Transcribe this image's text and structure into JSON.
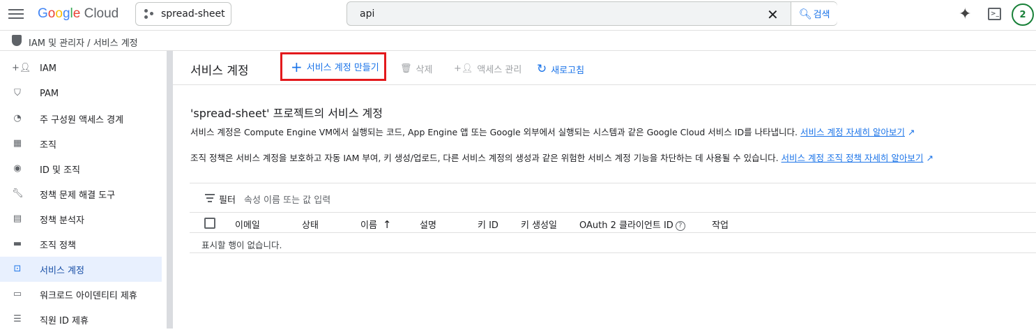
{
  "topbar": {
    "logo_google": "Google",
    "logo_cloud": "Cloud",
    "project": "spread-sheet",
    "search_value": "api",
    "search_button": "검색",
    "avatar": "2"
  },
  "breadcrumb": {
    "text": "IAM 및 관리자 / 서비스 계정"
  },
  "sidebar": {
    "items": [
      {
        "label": "IAM",
        "icon": "person-add-icon"
      },
      {
        "label": "PAM",
        "icon": "shield-icon"
      },
      {
        "label": "주 구성원 액세스 경계",
        "icon": "access-boundary-icon"
      },
      {
        "label": "조직",
        "icon": "organization-icon"
      },
      {
        "label": "ID 및 조직",
        "icon": "account-circle-icon"
      },
      {
        "label": "정책 문제 해결 도구",
        "icon": "wrench-icon"
      },
      {
        "label": "정책 분석자",
        "icon": "policy-analyzer-icon"
      },
      {
        "label": "조직 정책",
        "icon": "document-icon"
      },
      {
        "label": "서비스 계정",
        "icon": "service-account-icon"
      },
      {
        "label": "워크로드 아이덴티티 제휴",
        "icon": "id-card-icon"
      },
      {
        "label": "직원 ID 제휴",
        "icon": "list-icon"
      }
    ],
    "active_index": 8
  },
  "page": {
    "title": "서비스 계정",
    "toolbar": {
      "create": "서비스 계정 만들기",
      "delete": "삭제",
      "manage_access": "액세스 관리",
      "refresh": "새로고침"
    },
    "heading": "'spread-sheet' 프로젝트의 서비스 계정",
    "desc1": "서비스 계정은 Compute Engine VM에서 실행되는 코드, App Engine 앱 또는 Google 외부에서 실행되는 시스템과 같은 Google Cloud 서비스 ID를 나타냅니다.",
    "desc1_link": "서비스 계정 자세히 알아보기",
    "desc2": "조직 정책은 서비스 계정을 보호하고 자동 IAM 부여, 키 생성/업로드, 다른 서비스 계정의 생성과 같은 위험한 서비스 계정 기능을 차단하는 데 사용될 수 있습니다.",
    "desc2_link": "서비스 계정 조직 정책 자세히 알아보기"
  },
  "table": {
    "filter_label": "필터",
    "filter_placeholder": "속성 이름 또는 값 입력",
    "columns": [
      "이메일",
      "상태",
      "이름",
      "설명",
      "키 ID",
      "키 생성일",
      "OAuth 2 클라이언트 ID",
      "작업"
    ],
    "empty_text": "표시할 행이 없습니다."
  },
  "colors": {
    "accent": "#1a73e8",
    "highlight_border": "#e3191c",
    "active_bg": "#e8f0fe"
  }
}
